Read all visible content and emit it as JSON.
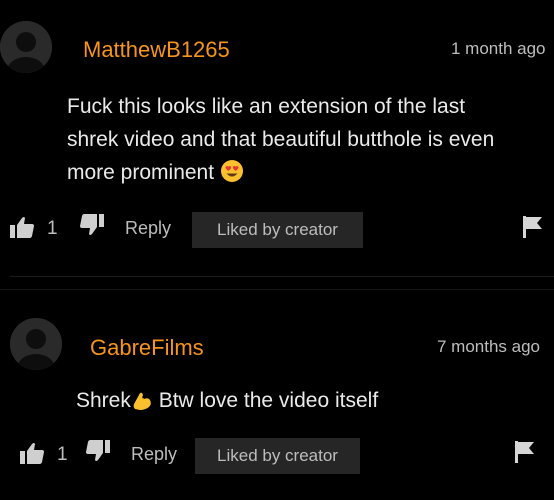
{
  "comments": [
    {
      "username": "MatthewB1265",
      "time": "1 month ago",
      "body_lines": [
        "Fuck this looks like an extension of the last",
        "shrek video and that beautiful butthole is even",
        "more prominent"
      ],
      "like_count": "1",
      "reply_label": "Reply",
      "liked_label": "Liked by creator"
    },
    {
      "username": "GabreFilms",
      "time": "7 months ago",
      "body_a": "Shrek",
      "body_b": "Btw love the video itself",
      "like_count": "1",
      "reply_label": "Reply",
      "liked_label": "Liked by creator"
    }
  ],
  "colors": {
    "username": "#f7941d",
    "background": "#000000",
    "badge": "#262626"
  }
}
